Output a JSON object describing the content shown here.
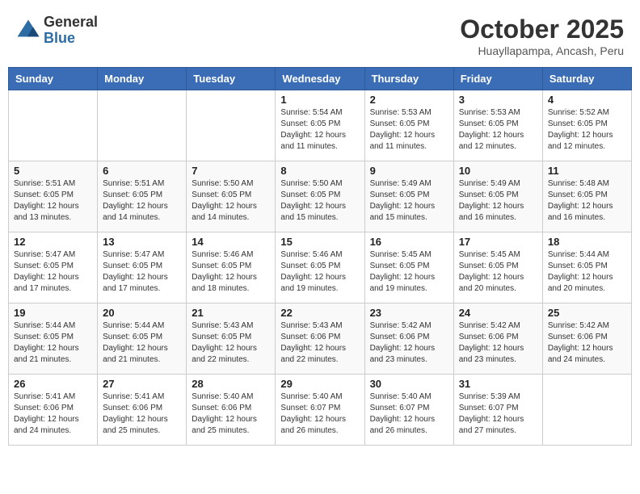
{
  "header": {
    "logo_general": "General",
    "logo_blue": "Blue",
    "month": "October 2025",
    "location": "Huayllapampa, Ancash, Peru"
  },
  "weekdays": [
    "Sunday",
    "Monday",
    "Tuesday",
    "Wednesday",
    "Thursday",
    "Friday",
    "Saturday"
  ],
  "weeks": [
    [
      {
        "day": "",
        "info": ""
      },
      {
        "day": "",
        "info": ""
      },
      {
        "day": "",
        "info": ""
      },
      {
        "day": "1",
        "info": "Sunrise: 5:54 AM\nSunset: 6:05 PM\nDaylight: 12 hours\nand 11 minutes."
      },
      {
        "day": "2",
        "info": "Sunrise: 5:53 AM\nSunset: 6:05 PM\nDaylight: 12 hours\nand 11 minutes."
      },
      {
        "day": "3",
        "info": "Sunrise: 5:53 AM\nSunset: 6:05 PM\nDaylight: 12 hours\nand 12 minutes."
      },
      {
        "day": "4",
        "info": "Sunrise: 5:52 AM\nSunset: 6:05 PM\nDaylight: 12 hours\nand 12 minutes."
      }
    ],
    [
      {
        "day": "5",
        "info": "Sunrise: 5:51 AM\nSunset: 6:05 PM\nDaylight: 12 hours\nand 13 minutes."
      },
      {
        "day": "6",
        "info": "Sunrise: 5:51 AM\nSunset: 6:05 PM\nDaylight: 12 hours\nand 14 minutes."
      },
      {
        "day": "7",
        "info": "Sunrise: 5:50 AM\nSunset: 6:05 PM\nDaylight: 12 hours\nand 14 minutes."
      },
      {
        "day": "8",
        "info": "Sunrise: 5:50 AM\nSunset: 6:05 PM\nDaylight: 12 hours\nand 15 minutes."
      },
      {
        "day": "9",
        "info": "Sunrise: 5:49 AM\nSunset: 6:05 PM\nDaylight: 12 hours\nand 15 minutes."
      },
      {
        "day": "10",
        "info": "Sunrise: 5:49 AM\nSunset: 6:05 PM\nDaylight: 12 hours\nand 16 minutes."
      },
      {
        "day": "11",
        "info": "Sunrise: 5:48 AM\nSunset: 6:05 PM\nDaylight: 12 hours\nand 16 minutes."
      }
    ],
    [
      {
        "day": "12",
        "info": "Sunrise: 5:47 AM\nSunset: 6:05 PM\nDaylight: 12 hours\nand 17 minutes."
      },
      {
        "day": "13",
        "info": "Sunrise: 5:47 AM\nSunset: 6:05 PM\nDaylight: 12 hours\nand 17 minutes."
      },
      {
        "day": "14",
        "info": "Sunrise: 5:46 AM\nSunset: 6:05 PM\nDaylight: 12 hours\nand 18 minutes."
      },
      {
        "day": "15",
        "info": "Sunrise: 5:46 AM\nSunset: 6:05 PM\nDaylight: 12 hours\nand 19 minutes."
      },
      {
        "day": "16",
        "info": "Sunrise: 5:45 AM\nSunset: 6:05 PM\nDaylight: 12 hours\nand 19 minutes."
      },
      {
        "day": "17",
        "info": "Sunrise: 5:45 AM\nSunset: 6:05 PM\nDaylight: 12 hours\nand 20 minutes."
      },
      {
        "day": "18",
        "info": "Sunrise: 5:44 AM\nSunset: 6:05 PM\nDaylight: 12 hours\nand 20 minutes."
      }
    ],
    [
      {
        "day": "19",
        "info": "Sunrise: 5:44 AM\nSunset: 6:05 PM\nDaylight: 12 hours\nand 21 minutes."
      },
      {
        "day": "20",
        "info": "Sunrise: 5:44 AM\nSunset: 6:05 PM\nDaylight: 12 hours\nand 21 minutes."
      },
      {
        "day": "21",
        "info": "Sunrise: 5:43 AM\nSunset: 6:05 PM\nDaylight: 12 hours\nand 22 minutes."
      },
      {
        "day": "22",
        "info": "Sunrise: 5:43 AM\nSunset: 6:06 PM\nDaylight: 12 hours\nand 22 minutes."
      },
      {
        "day": "23",
        "info": "Sunrise: 5:42 AM\nSunset: 6:06 PM\nDaylight: 12 hours\nand 23 minutes."
      },
      {
        "day": "24",
        "info": "Sunrise: 5:42 AM\nSunset: 6:06 PM\nDaylight: 12 hours\nand 23 minutes."
      },
      {
        "day": "25",
        "info": "Sunrise: 5:42 AM\nSunset: 6:06 PM\nDaylight: 12 hours\nand 24 minutes."
      }
    ],
    [
      {
        "day": "26",
        "info": "Sunrise: 5:41 AM\nSunset: 6:06 PM\nDaylight: 12 hours\nand 24 minutes."
      },
      {
        "day": "27",
        "info": "Sunrise: 5:41 AM\nSunset: 6:06 PM\nDaylight: 12 hours\nand 25 minutes."
      },
      {
        "day": "28",
        "info": "Sunrise: 5:40 AM\nSunset: 6:06 PM\nDaylight: 12 hours\nand 25 minutes."
      },
      {
        "day": "29",
        "info": "Sunrise: 5:40 AM\nSunset: 6:07 PM\nDaylight: 12 hours\nand 26 minutes."
      },
      {
        "day": "30",
        "info": "Sunrise: 5:40 AM\nSunset: 6:07 PM\nDaylight: 12 hours\nand 26 minutes."
      },
      {
        "day": "31",
        "info": "Sunrise: 5:39 AM\nSunset: 6:07 PM\nDaylight: 12 hours\nand 27 minutes."
      },
      {
        "day": "",
        "info": ""
      }
    ]
  ]
}
